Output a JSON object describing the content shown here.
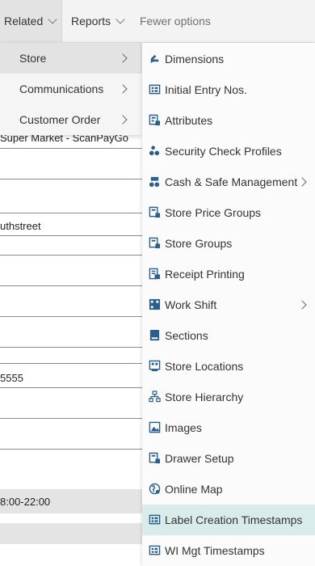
{
  "actionbar": {
    "related": "Related",
    "reports": "Reports",
    "fewer": "Fewer options"
  },
  "background": {
    "store_name": "Super Market - ScanPayGo",
    "street": "uthstreet",
    "phone": "5555",
    "hours": "8:00-22:00"
  },
  "menu1": {
    "items": [
      {
        "label": "Store"
      },
      {
        "label": "Communications"
      },
      {
        "label": "Customer Order"
      }
    ]
  },
  "submenu": {
    "items": [
      {
        "label": "Dimensions",
        "icon": "dimensions-icon"
      },
      {
        "label": "Initial Entry Nos.",
        "icon": "list-table-icon"
      },
      {
        "label": "Attributes",
        "icon": "attributes-icon"
      },
      {
        "label": "Security Check Profiles",
        "icon": "security-icon"
      },
      {
        "label": "Cash & Safe Management",
        "icon": "cash-icon"
      },
      {
        "label": "Store Price Groups",
        "icon": "price-group-icon"
      },
      {
        "label": "Store Groups",
        "icon": "store-group-icon"
      },
      {
        "label": "Receipt Printing",
        "icon": "receipt-icon"
      },
      {
        "label": "Work Shift",
        "icon": "work-shift-icon"
      },
      {
        "label": "Sections",
        "icon": "sections-icon"
      },
      {
        "label": "Store Locations",
        "icon": "locations-icon"
      },
      {
        "label": "Store Hierarchy",
        "icon": "hierarchy-icon"
      },
      {
        "label": "Images",
        "icon": "images-icon"
      },
      {
        "label": "Drawer Setup",
        "icon": "drawer-icon"
      },
      {
        "label": "Online Map",
        "icon": "globe-icon"
      },
      {
        "label": "Label Creation Timestamps",
        "icon": "timestamp-icon"
      },
      {
        "label": "WI Mgt Timestamps",
        "icon": "timestamp-icon"
      }
    ]
  },
  "colors": {
    "icon_blue": "#2b5f8a",
    "highlight": "#d9eceb"
  }
}
